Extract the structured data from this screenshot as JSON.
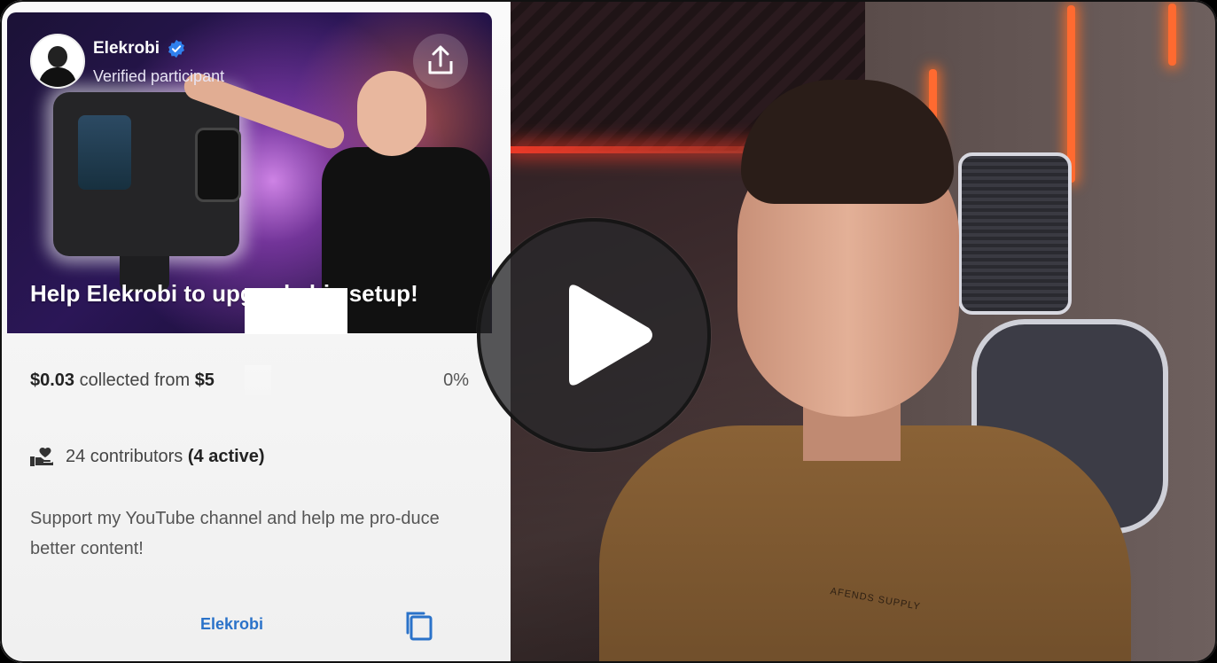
{
  "card": {
    "username": "Elekrobi",
    "verified_label": "Verified participant",
    "hero_title": "Help Elekrobi to upgrade his setup!",
    "collected_amount": "$0.03",
    "collected_text": "collected from",
    "goal_amount": "$5",
    "progress_percent": "0%",
    "contributors_text": "24 contributors",
    "active_text": "(4 active)",
    "description": "Support my YouTube channel and help me pro-duce better content!",
    "footer_link": "Elekrobi"
  },
  "video": {
    "shirt_text": "AFENDS SUPPLY"
  },
  "colors": {
    "accent_blue": "#2a72c9",
    "verified_blue": "#2f80ed",
    "neon_orange": "#ff6a30"
  },
  "icons": {
    "verified": "verified-badge-icon",
    "share": "share-upload-icon",
    "contributors": "hand-heart-icon",
    "copy": "copy-icon",
    "play": "play-icon"
  }
}
